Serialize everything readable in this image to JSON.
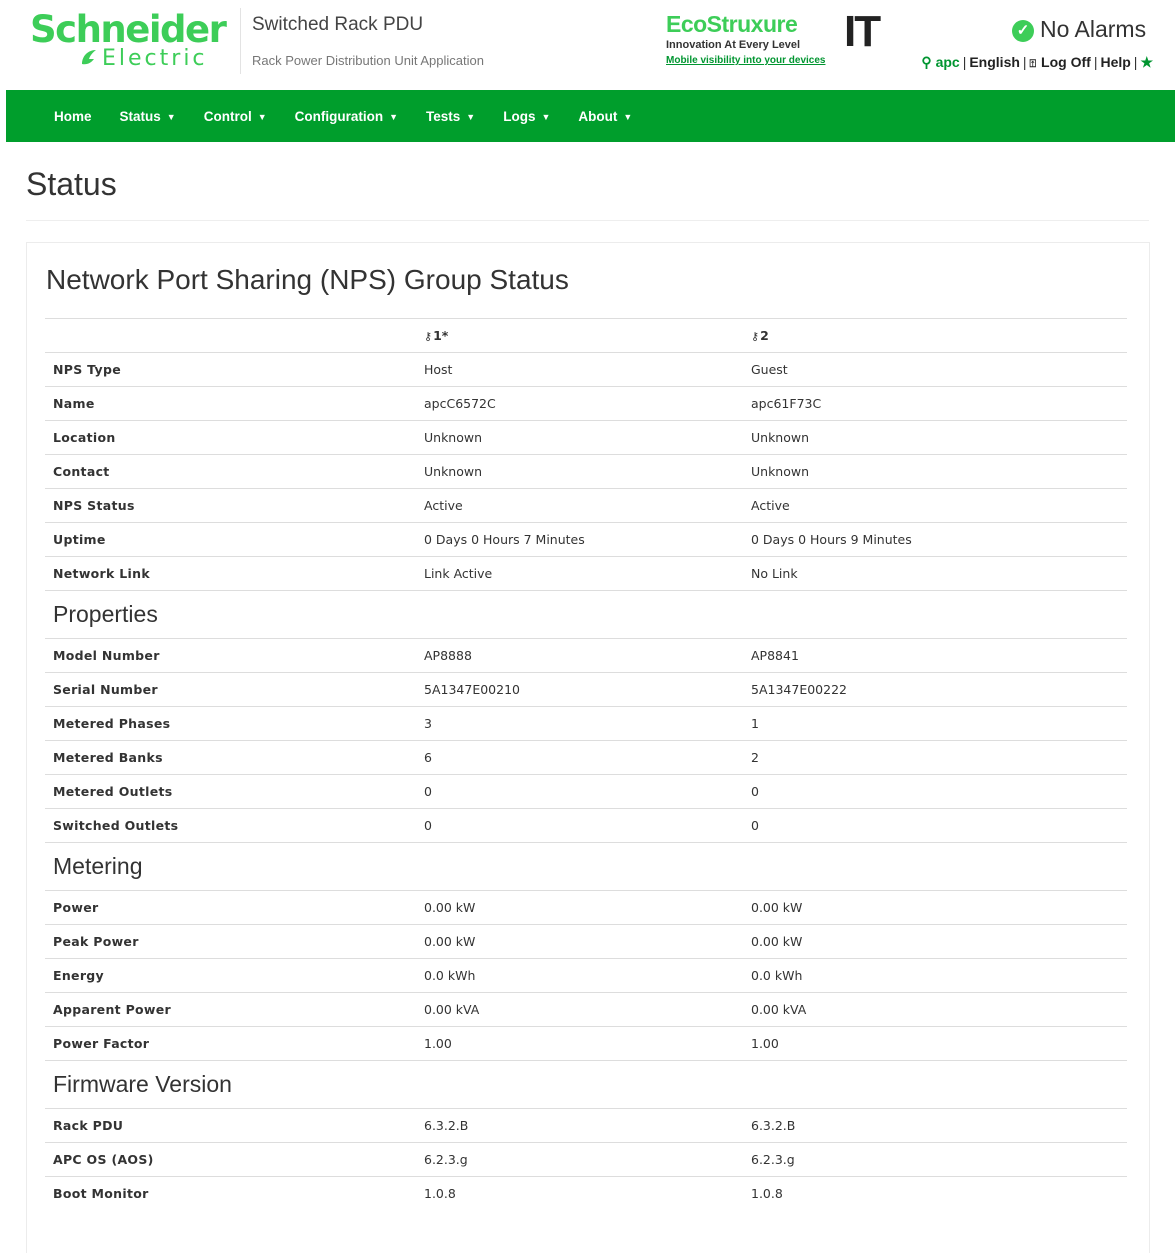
{
  "header": {
    "brand_line1": "Schneider",
    "brand_line2": "Electric",
    "app_title": "Switched Rack PDU",
    "app_subtitle": "Rack Power Distribution Unit Application",
    "eco_name": "EcoStruxure",
    "eco_it": "IT",
    "eco_tagline": "Innovation At Every Level",
    "eco_link": "Mobile visibility into your devices",
    "alarm_status": "No Alarms",
    "user": "apc",
    "language": "English",
    "logoff": "Log Off",
    "help": "Help"
  },
  "nav": [
    {
      "label": "Home"
    },
    {
      "label": "Status"
    },
    {
      "label": "Control"
    },
    {
      "label": "Configuration"
    },
    {
      "label": "Tests"
    },
    {
      "label": "Logs"
    },
    {
      "label": "About"
    }
  ],
  "page_title": "Status",
  "panel_title": "Network Port Sharing (NPS)  Group Status",
  "columns": {
    "c1": "1*",
    "c2": "2"
  },
  "rows_general": [
    {
      "label": "NPS Type",
      "v1": "Host",
      "v2": "Guest"
    },
    {
      "label": "Name",
      "v1": "apcC6572C",
      "v2": "apc61F73C"
    },
    {
      "label": "Location",
      "v1": "Unknown",
      "v2": "Unknown"
    },
    {
      "label": "Contact",
      "v1": "Unknown",
      "v2": "Unknown"
    },
    {
      "label": "NPS Status",
      "v1": "Active",
      "v2": "Active"
    },
    {
      "label": "Uptime",
      "v1": "0 Days 0 Hours 7 Minutes",
      "v2": "0 Days 0 Hours 9 Minutes"
    },
    {
      "label": "Network Link",
      "v1": "Link Active",
      "v2": "No Link"
    }
  ],
  "sec_properties": "Properties",
  "rows_properties": [
    {
      "label": "Model Number",
      "v1": "AP8888",
      "v2": "AP8841"
    },
    {
      "label": "Serial Number",
      "v1": "5A1347E00210",
      "v2": "5A1347E00222"
    },
    {
      "label": "Metered Phases",
      "v1": "3",
      "v2": "1"
    },
    {
      "label": "Metered Banks",
      "v1": "6",
      "v2": "2"
    },
    {
      "label": "Metered Outlets",
      "v1": "0",
      "v2": "0"
    },
    {
      "label": "Switched Outlets",
      "v1": "0",
      "v2": "0"
    }
  ],
  "sec_metering": "Metering",
  "rows_metering": [
    {
      "label": "Power",
      "v1": "0.00 kW",
      "v2": "0.00 kW"
    },
    {
      "label": "Peak Power",
      "v1": "0.00 kW",
      "v2": "0.00 kW"
    },
    {
      "label": "Energy",
      "v1": "0.0 kWh",
      "v2": "0.0 kWh"
    },
    {
      "label": "Apparent Power",
      "v1": "0.00 kVA",
      "v2": "0.00 kVA"
    },
    {
      "label": "Power Factor",
      "v1": "1.00",
      "v2": "1.00"
    }
  ],
  "sec_firmware": "Firmware Version",
  "rows_firmware": [
    {
      "label": "Rack PDU",
      "v1": "6.3.2.B",
      "v2": "6.3.2.B"
    },
    {
      "label": "APC OS (AOS)",
      "v1": "6.2.3.g",
      "v2": "6.2.3.g"
    },
    {
      "label": "Boot Monitor",
      "v1": "1.0.8",
      "v2": "1.0.8"
    }
  ]
}
